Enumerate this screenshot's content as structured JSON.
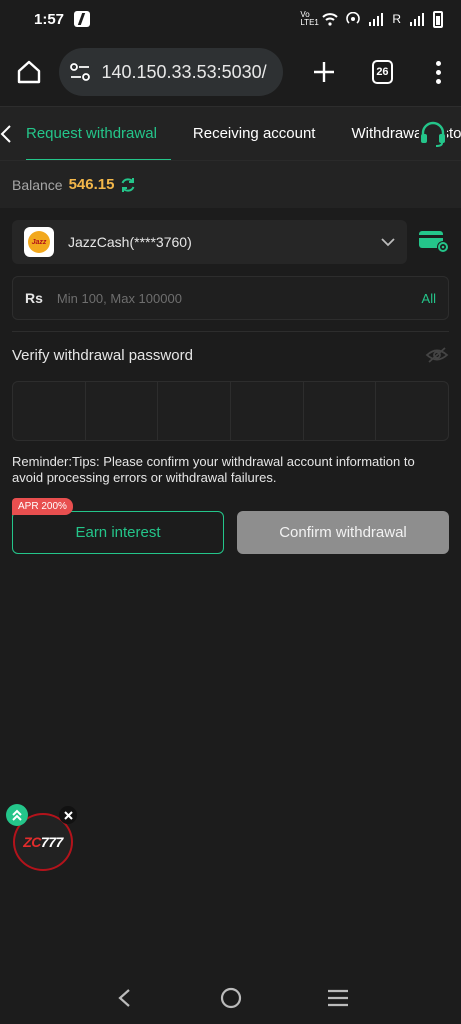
{
  "status_bar": {
    "time": "1:57",
    "network_label": "Vo LTE1",
    "roaming": "R"
  },
  "browser": {
    "url": "140.150.33.53:5030/",
    "tab_count": "26"
  },
  "app_nav": {
    "tabs": [
      {
        "label": "Request withdrawal",
        "active": true
      },
      {
        "label": "Receiving account",
        "active": false
      },
      {
        "label": "Withdrawal history",
        "active": false
      }
    ]
  },
  "balance": {
    "label": "Balance",
    "value": "546.15"
  },
  "account": {
    "selected": "JazzCash(****3760)",
    "logo_text": "Jazz"
  },
  "amount": {
    "currency": "Rs",
    "placeholder": "Min 100, Max 100000",
    "all_label": "All"
  },
  "password": {
    "label": "Verify withdrawal password",
    "digit_count": 6
  },
  "reminder": "Reminder:Tips: Please confirm your withdrawal account information to avoid processing errors or withdrawal failures.",
  "buttons": {
    "apr_badge": "APR 200%",
    "earn_interest": "Earn interest",
    "confirm_withdrawal": "Confirm withdrawal"
  },
  "float_logo": {
    "text_prefix": "ZC",
    "text_suffix": "777"
  },
  "colors": {
    "accent": "#24c58a",
    "balance": "#f3b74a",
    "badge": "#e84f4f",
    "disabled_button": "#8e8e8e"
  }
}
